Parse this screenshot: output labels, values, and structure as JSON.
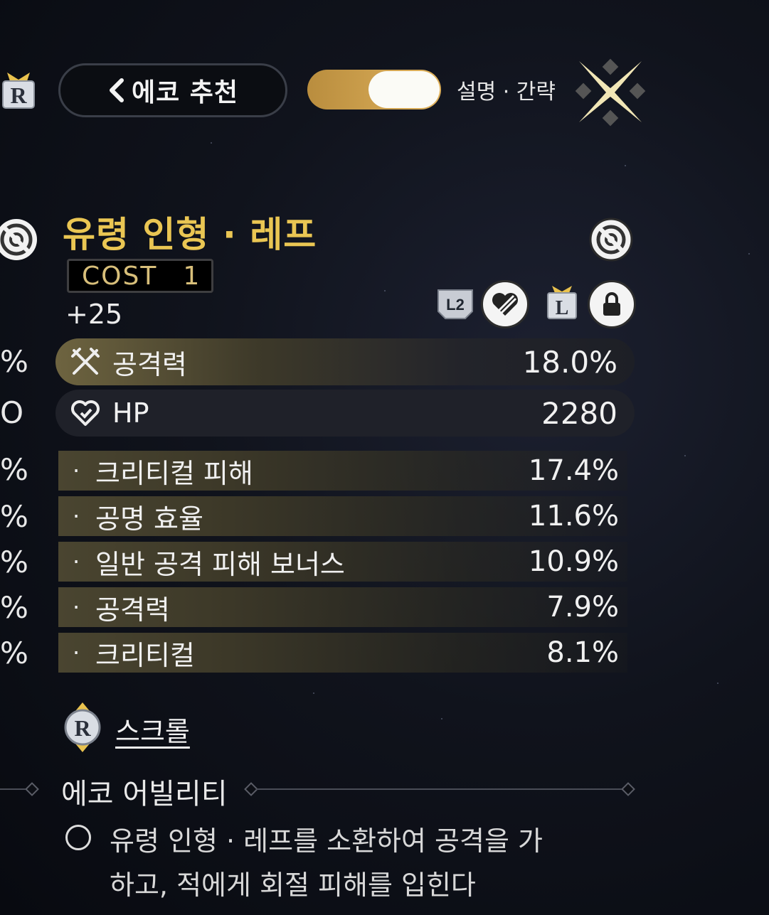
{
  "header": {
    "back_label": "에코 추천",
    "toggle_label": "설명 · 간략",
    "toggle_state": "on"
  },
  "echo": {
    "name": "유령 인형 · 레프",
    "cost_label": "COST",
    "cost_value": "1",
    "level": "+25",
    "badge_l2": "L2"
  },
  "main_stats": [
    {
      "name": "공격력",
      "value": "18.0%",
      "icon": "crossed-swords-icon"
    },
    {
      "name": "HP",
      "value": "2280",
      "icon": "heart-icon"
    }
  ],
  "sub_stats": [
    {
      "name": "크리티컬 피해",
      "value": "17.4%"
    },
    {
      "name": "공명 효율",
      "value": "11.6%"
    },
    {
      "name": "일반 공격 피해 보너스",
      "value": "10.9%"
    },
    {
      "name": "공격력",
      "value": "7.9%"
    },
    {
      "name": "크리티컬",
      "value": "8.1%"
    }
  ],
  "left_column_fragments": [
    "%",
    "O",
    "%",
    "%",
    "%",
    "%",
    "%"
  ],
  "scroll": {
    "label": "스크롤"
  },
  "ability": {
    "title": "에코 어빌리티",
    "description": "유령 인형 · 레프를 소환하여 공격을 가하고, 적에게 회절 피해를 입힌다"
  },
  "colors": {
    "title_gold": "#eac653",
    "toggle_gold": "#e0b25c",
    "main_row_gold": "#6b5f3a"
  }
}
